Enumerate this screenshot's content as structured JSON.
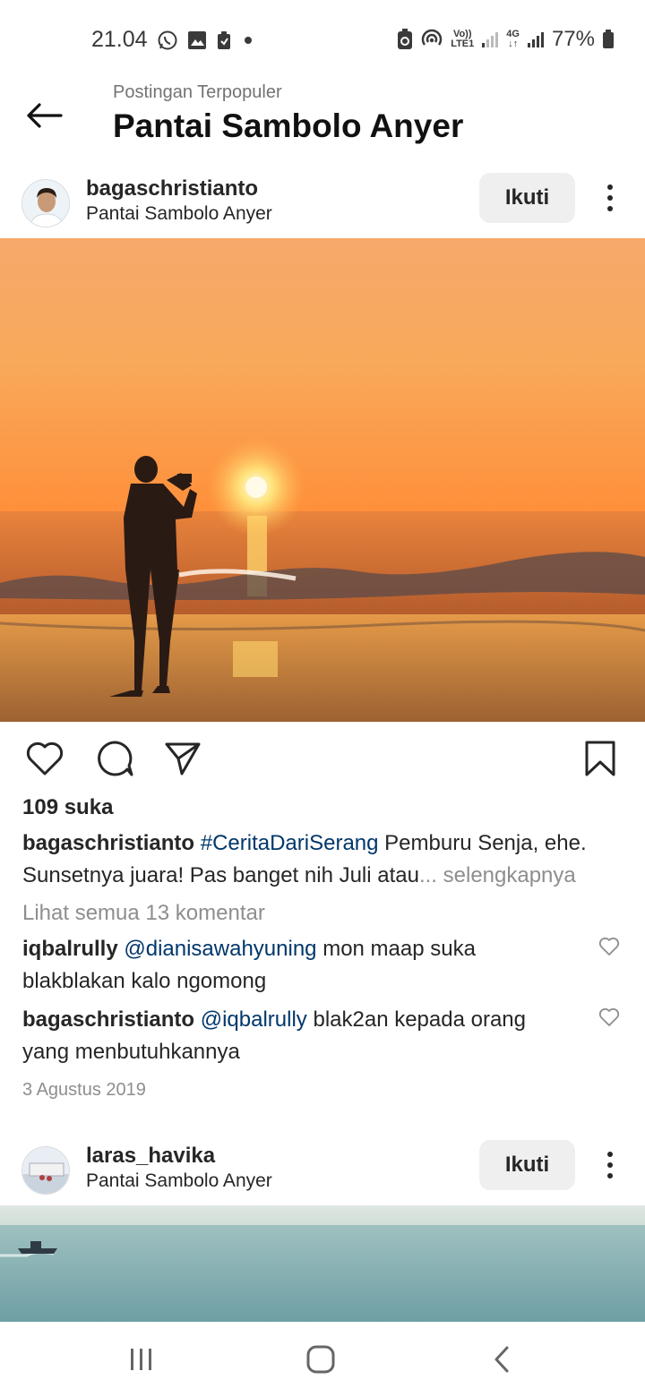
{
  "status_bar": {
    "time": "21.04",
    "battery": "77%",
    "net_volte_top": "Vo))",
    "net_volte_bottom": "LTE1",
    "net_4g_top": "4G",
    "net_4g_bottom": "↓↑"
  },
  "header": {
    "subtitle": "Postingan Terpopuler",
    "title": "Pantai Sambolo Anyer"
  },
  "posts": [
    {
      "username": "bagaschristianto",
      "location": "Pantai Sambolo Anyer",
      "follow_label": "Ikuti",
      "likes": "109 suka",
      "caption": {
        "username": "bagaschristianto",
        "hashtag": "#CeritaDariSerang",
        "text1": " Pemburu Senja, ehe.",
        "text2": "Sunsetnya juara! Pas banget nih Juli atau",
        "more": "... selengkapnya"
      },
      "view_all_comments": "Lihat semua 13 komentar",
      "comments": [
        {
          "username": "iqbalrully",
          "mention": "@dianisawahyuning",
          "text": " mon maap suka blakblakan kalo ngomong"
        },
        {
          "username": "bagaschristianto",
          "mention": "@iqbalrully",
          "text": " blak2an kepada orang yang menbutuhkannya"
        }
      ],
      "date": "3 Agustus 2019"
    },
    {
      "username": "laras_havika",
      "location": "Pantai Sambolo Anyer",
      "follow_label": "Ikuti"
    }
  ],
  "icons": {
    "back": "arrow-left-icon",
    "like": "heart-icon",
    "comment": "comment-icon",
    "share": "send-icon",
    "save": "bookmark-icon",
    "more": "more-vertical-icon"
  },
  "colors": {
    "link": "#00376b",
    "muted": "#8e8e8e",
    "text": "#262626",
    "button_bg": "#efefef"
  }
}
